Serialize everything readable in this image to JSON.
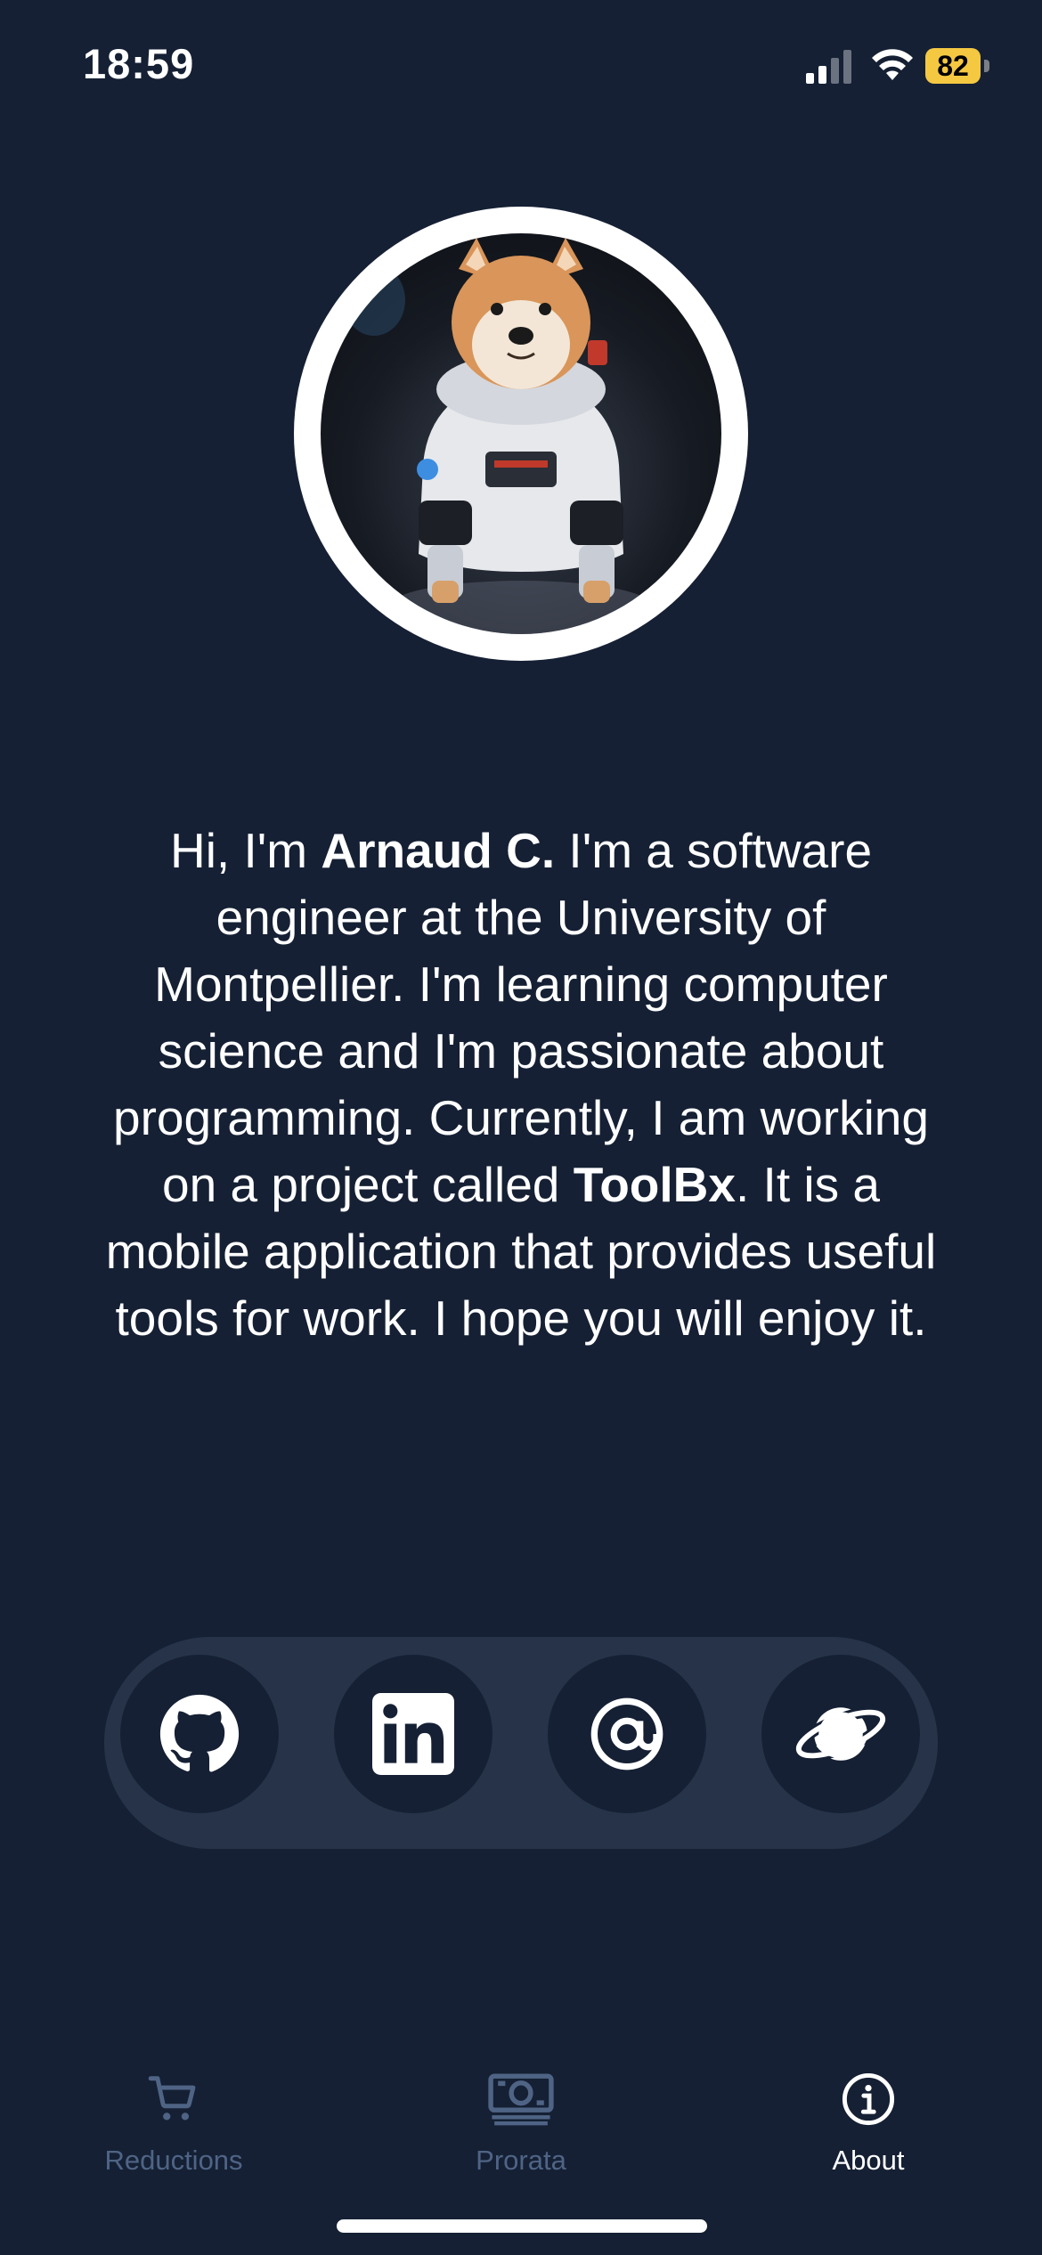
{
  "status_bar": {
    "time": "18:59",
    "battery": "82"
  },
  "bio": {
    "part1": "Hi, I'm ",
    "name": "Arnaud C.",
    "part2": " I'm a software engineer at the University of Montpellier. I'm learning computer science and I'm passionate about programming. Currently, I am working on a project called ",
    "project": "ToolBx",
    "part3": ". It is a mobile application that provides useful tools for work. I hope you will enjoy it."
  },
  "social_links": [
    {
      "icon": "github-icon"
    },
    {
      "icon": "linkedin-icon"
    },
    {
      "icon": "email-at-icon"
    },
    {
      "icon": "planet-website-icon"
    }
  ],
  "tabs": [
    {
      "label": "Reductions",
      "icon": "cart-icon",
      "active": false
    },
    {
      "label": "Prorata",
      "icon": "banknote-icon",
      "active": false
    },
    {
      "label": "About",
      "icon": "info-icon",
      "active": true
    }
  ],
  "colors": {
    "background": "#152034",
    "panel": "#263349",
    "inactive_tab": "#4f6485",
    "battery": "#f5c842"
  }
}
